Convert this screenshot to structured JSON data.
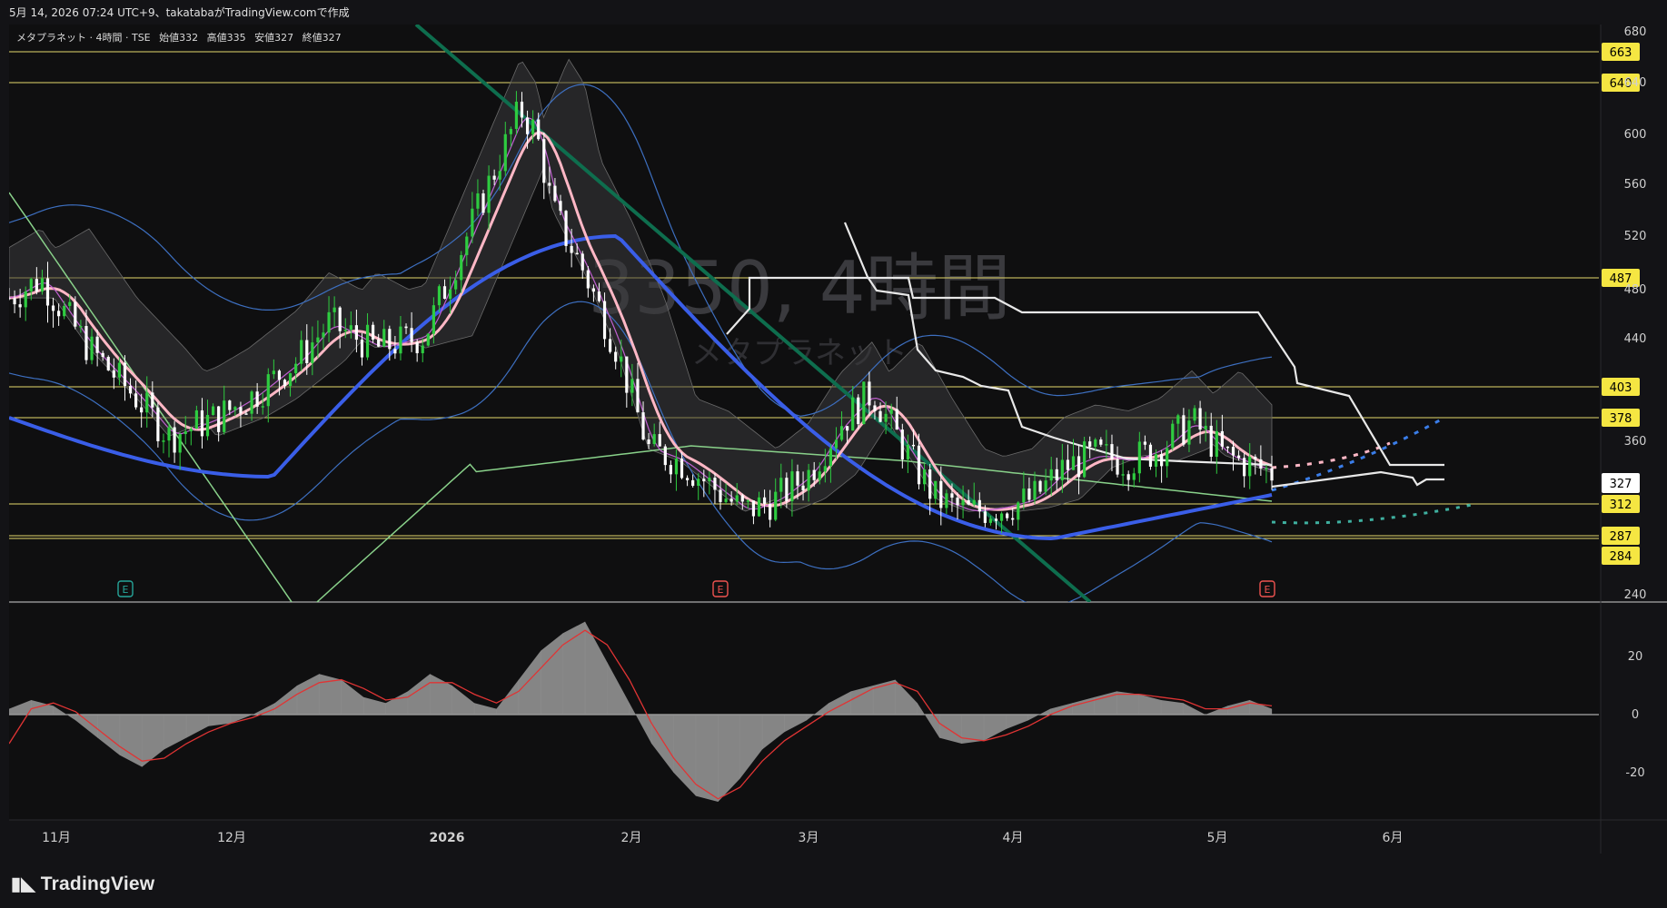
{
  "header": {
    "attribution": "5月 14, 2026 07:24 UTC+9、takatabaがTradingView.comで作成",
    "legend_name": "メタプラネット · 4時間 · TSE",
    "open_label": "始値",
    "open_value": "332",
    "high_label": "高値",
    "high_value": "335",
    "low_label": "安値",
    "low_value": "327",
    "close_label": "終値",
    "close_value": "327"
  },
  "watermark": {
    "line1": "3350, 4時間",
    "line2": "メタプラネット"
  },
  "footer": {
    "brand": "TradingView"
  },
  "colors": {
    "background": "#0f0f10",
    "bull_candle": "#2ecc40",
    "bear_candle": "#ffffff",
    "hline": "#e6d96b",
    "hline_label_bg": "#f5e642",
    "price_label_bg": "#ffffff",
    "ma_short": "#ffb7c5",
    "ma_mid": "#3a5ee8",
    "ma_fast": "#c060d0",
    "bollinger": "#3d6fc0",
    "green_ma": "#89d18a",
    "trend_line": "#0e6e4e",
    "ichimoku_white": "#e8e8e8",
    "macd_hist": "#9a9a9a",
    "macd_signal": "#e03434"
  },
  "chart_data": [
    {
      "type": "candlestick",
      "title": "メタプラネット · 4時間 · TSE",
      "x_ticks": [
        "11月",
        "12月",
        "2026",
        "2月",
        "3月",
        "4月",
        "5月",
        "6月"
      ],
      "y_ticks": [
        240,
        280,
        320,
        360,
        400,
        440,
        480,
        520,
        560,
        600,
        640,
        680
      ],
      "y_tick_labels": [
        "240",
        "",
        "",
        "360",
        "",
        "440",
        "480",
        "520",
        "560",
        "600",
        "640",
        "680"
      ],
      "ylim": [
        240,
        680
      ],
      "current_price": 327,
      "ohlc_last": {
        "open": 332,
        "high": 335,
        "low": 327,
        "close": 327
      },
      "horizontal_levels": [
        663,
        640,
        487,
        403,
        378,
        312,
        287,
        284
      ],
      "earnings_markers": [
        {
          "label": "E",
          "x": "10月下旬",
          "color": "#26a69a"
        },
        {
          "label": "E",
          "x": "2月中旬",
          "color": "#ef5350"
        },
        {
          "label": "E",
          "x": "5月中旬",
          "color": "#ef5350"
        }
      ],
      "series": [
        {
          "name": "price_path",
          "x": [
            0.0,
            0.02,
            0.05,
            0.08,
            0.1,
            0.13,
            0.15,
            0.18,
            0.2,
            0.23,
            0.26,
            0.28,
            0.3,
            0.32,
            0.33,
            0.34,
            0.36,
            0.38,
            0.4,
            0.42,
            0.44,
            0.46,
            0.48,
            0.5,
            0.52,
            0.54,
            0.56,
            0.58,
            0.6,
            0.62,
            0.64,
            0.66,
            0.68,
            0.7,
            0.72,
            0.74,
            0.76,
            0.79
          ],
          "values": [
            470,
            485,
            430,
            390,
            360,
            375,
            390,
            420,
            450,
            430,
            440,
            500,
            560,
            620,
            600,
            540,
            490,
            430,
            350,
            340,
            320,
            300,
            310,
            330,
            370,
            395,
            350,
            310,
            300,
            303,
            310,
            335,
            345,
            340,
            350,
            372,
            345,
            331
          ]
        }
      ]
    },
    {
      "type": "bar",
      "title": "MACD",
      "y_ticks": [
        20,
        0,
        -20
      ],
      "ylim": [
        -32,
        35
      ],
      "series": [
        {
          "name": "histogram",
          "values": [
            2,
            5,
            3,
            -2,
            -8,
            -14,
            -18,
            -12,
            -8,
            -4,
            -3,
            0,
            4,
            10,
            14,
            12,
            6,
            4,
            8,
            14,
            10,
            4,
            2,
            12,
            22,
            28,
            32,
            18,
            4,
            -10,
            -20,
            -28,
            -30,
            -22,
            -12,
            -6,
            -2,
            4,
            8,
            10,
            12,
            4,
            -8,
            -10,
            -9,
            -5,
            -2,
            2,
            4,
            6,
            8,
            7,
            5,
            4,
            0,
            3,
            5,
            2
          ]
        },
        {
          "name": "signal",
          "values": [
            -10,
            2,
            4,
            1,
            -5,
            -11,
            -16,
            -15,
            -10,
            -6,
            -3,
            -1,
            2,
            7,
            11,
            12,
            9,
            5,
            6,
            11,
            11,
            7,
            4,
            8,
            16,
            24,
            29,
            24,
            12,
            -3,
            -15,
            -24,
            -29,
            -25,
            -16,
            -9,
            -4,
            1,
            5,
            9,
            11,
            8,
            -3,
            -8,
            -9,
            -7,
            -4,
            0,
            3,
            5,
            7,
            7,
            6,
            5,
            2,
            2,
            4,
            3
          ]
        }
      ]
    }
  ]
}
